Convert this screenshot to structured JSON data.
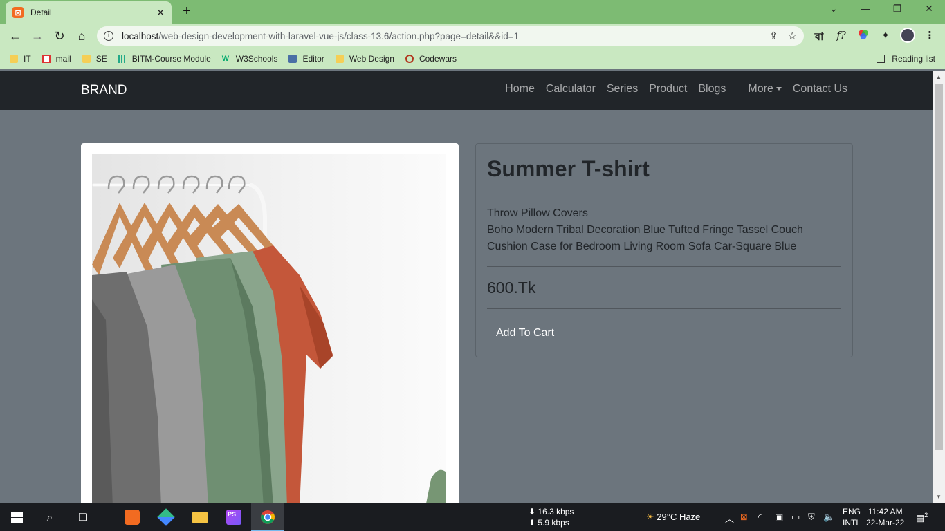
{
  "browser": {
    "tab_title": "Detail",
    "tab_close": "✕",
    "new_tab": "+",
    "url_host": "localhost",
    "url_path": "/web-design-development-with-laravel-vue-js/class-13.6/action.php?page=detail&&id=1",
    "bookmarks": [
      {
        "label": "IT",
        "icon": "folder-icon"
      },
      {
        "label": "mail",
        "icon": "gmail-icon"
      },
      {
        "label": "SE",
        "icon": "folder-icon"
      },
      {
        "label": "BITM-Course Module",
        "icon": "bitm-icon"
      },
      {
        "label": "W3Schools",
        "icon": "w3schools-icon"
      },
      {
        "label": "Editor",
        "icon": "editor-icon"
      },
      {
        "label": "Web Design",
        "icon": "folder-icon"
      },
      {
        "label": "Codewars",
        "icon": "codewars-icon"
      }
    ],
    "reading_list": "Reading list",
    "ext_bangla": "বা",
    "ext_formula": "f?"
  },
  "navbar": {
    "brand": "BRAND",
    "links": [
      "Home",
      "Calculator",
      "Series",
      "Product",
      "Blogs",
      "More",
      "Contact Us"
    ]
  },
  "product": {
    "title": "Summer T-shirt",
    "description_line1": "Throw Pillow Covers",
    "description_line2": "Boho Modern Tribal Decoration Blue Tufted Fringe Tassel Couch Cushion Case for Bedroom Living Room Sofa Car-Square Blue",
    "price": "600.Tk",
    "add_to_cart": "Add To Cart"
  },
  "taskbar": {
    "net_down": "16.3 kbps",
    "net_up": "5.9 kbps",
    "weather": "29°C  Haze",
    "lang1": "ENG",
    "lang2": "INTL",
    "time": "11:42 AM",
    "date": "22-Mar-22",
    "notifications": "2"
  },
  "colors": {
    "navbar_bg": "#212529",
    "page_bg": "#6c757d",
    "chrome_tabbar": "#7dbb73",
    "chrome_toolbar": "#c9e8c1"
  }
}
